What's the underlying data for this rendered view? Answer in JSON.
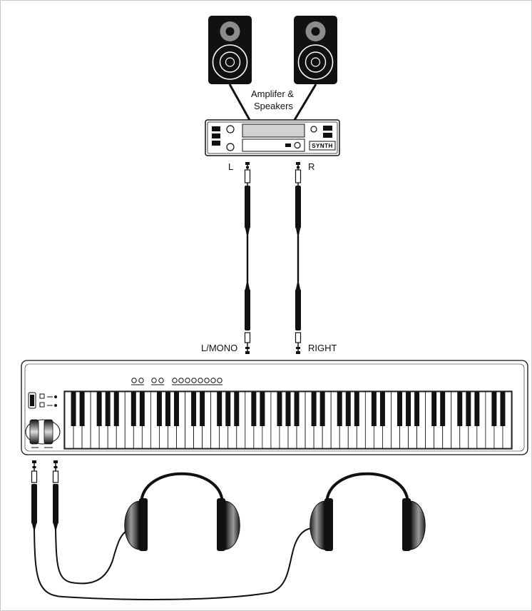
{
  "amp": {
    "caption_line1": "Amplifer &",
    "caption_line2": "Speakers",
    "brand": "SYNTH"
  },
  "outputs": {
    "left_input": "L",
    "right_input": "R",
    "left_output": "L/MONO",
    "right_output": "RIGHT"
  },
  "keyboard": {
    "white_keys": 52,
    "octave_pattern": [
      1,
      1,
      0,
      1,
      1,
      1,
      0
    ]
  },
  "colors": {
    "line": "#111111",
    "frame": "#c8c8c8",
    "speaker": "#111111",
    "speaker_cone": "#888888"
  },
  "icons": [
    "speaker-icon",
    "amplifier-icon",
    "jack-cable-icon",
    "keyboard-icon",
    "headphones-icon"
  ]
}
